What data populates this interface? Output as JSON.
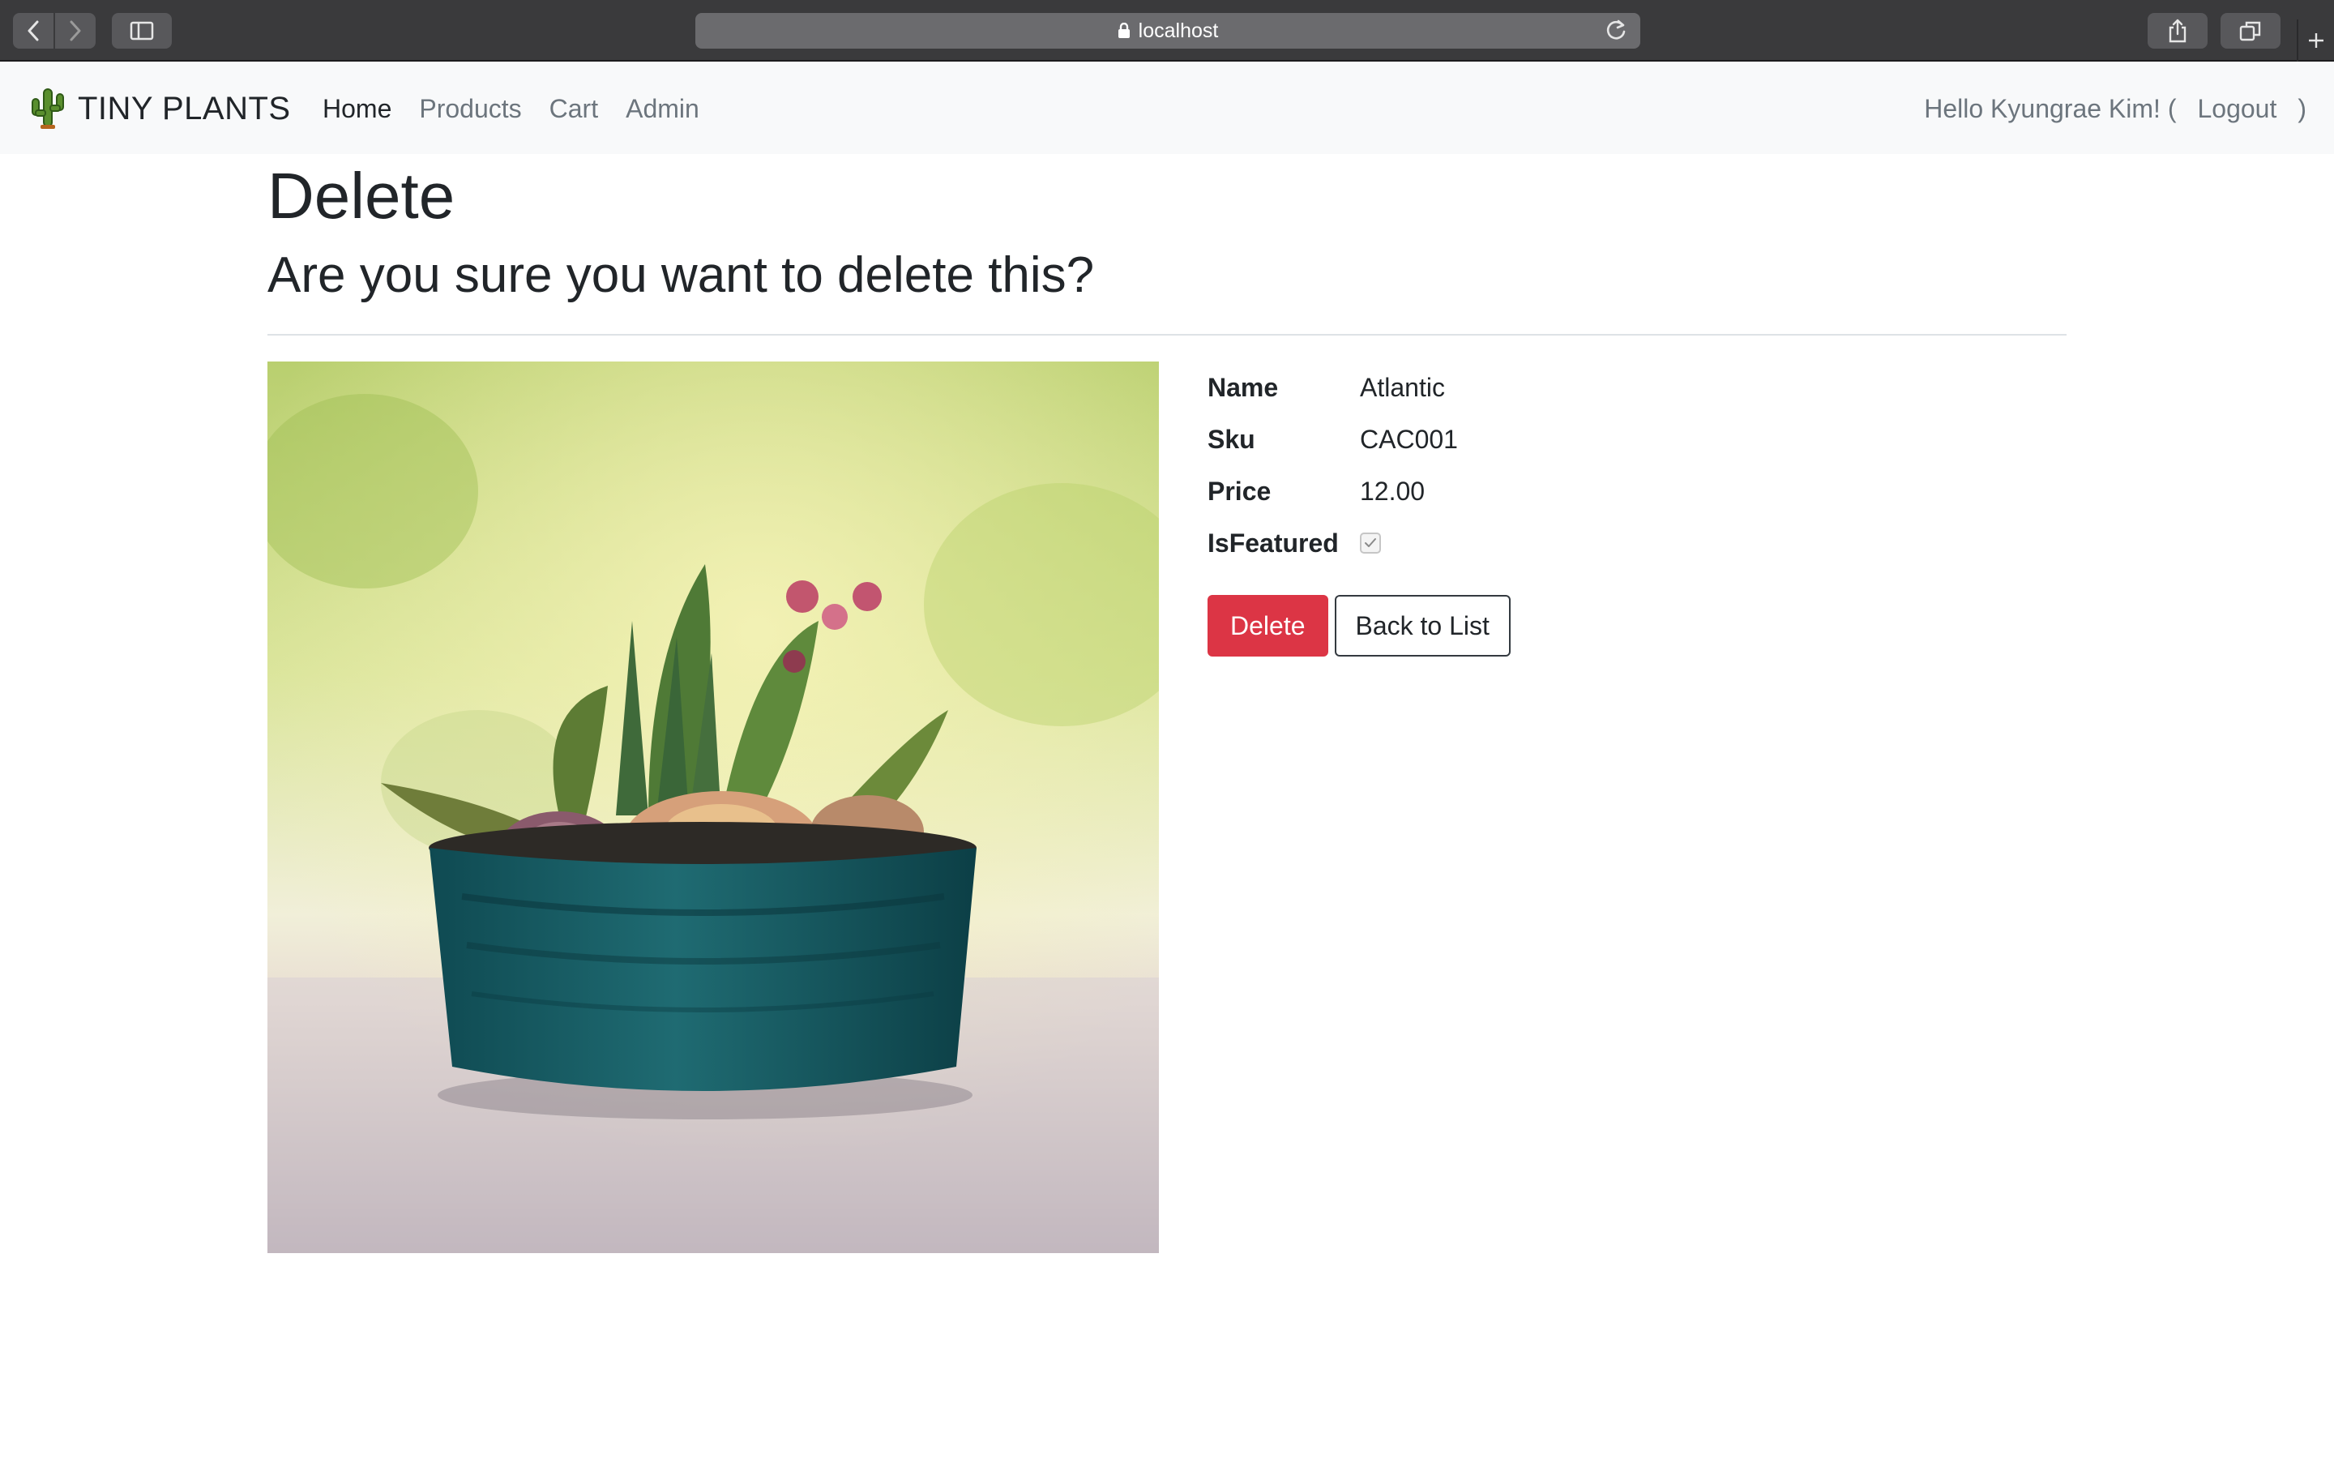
{
  "browser": {
    "url": "localhost"
  },
  "navbar": {
    "brand": "TINY PLANTS",
    "links": [
      {
        "label": "Home"
      },
      {
        "label": "Products"
      },
      {
        "label": "Cart"
      },
      {
        "label": "Admin"
      }
    ],
    "greeting": "Hello Kyungrae Kim! (",
    "logout": "Logout",
    "close_paren": ")"
  },
  "page": {
    "title": "Delete",
    "question": "Are you sure you want to delete this?"
  },
  "product": {
    "image_icon": "potted-succulent-photo",
    "fields": [
      {
        "label": "Name",
        "value": "Atlantic"
      },
      {
        "label": "Sku",
        "value": "CAC001"
      },
      {
        "label": "Price",
        "value": "12.00"
      },
      {
        "label": "IsFeatured",
        "checked": true
      }
    ]
  },
  "actions": {
    "delete_label": "Delete",
    "back_label": "Back to List"
  },
  "colors": {
    "danger": "#dc3545",
    "navbar_bg": "#f8f9fa",
    "chrome_bg": "#3a3a3c"
  }
}
